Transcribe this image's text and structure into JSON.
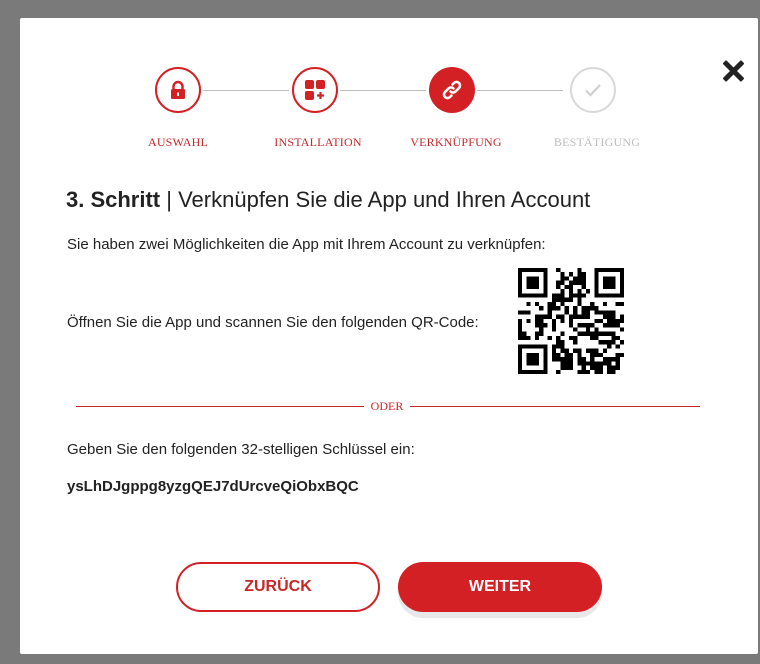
{
  "close_icon": "close-icon",
  "steps": [
    {
      "label": "AUSWAHL",
      "icon": "lock-icon",
      "state": "done"
    },
    {
      "label": "INSTALLATION",
      "icon": "app-grid-icon",
      "state": "done"
    },
    {
      "label": "VERKNÜPFUNG",
      "icon": "link-icon",
      "state": "active"
    },
    {
      "label": "BESTÄTIGUNG",
      "icon": "check-icon",
      "state": "upcoming"
    }
  ],
  "heading": {
    "step": "3. Schritt",
    "separator": " | ",
    "text": "Verknüpfen Sie die App und Ihren Account"
  },
  "intro": "Sie haben zwei Möglichkeiten die App mit Ihrem Account zu verknüpfen:",
  "qr_instruction": "Öffnen Sie die App und scannen Sie den folgenden QR-Code:",
  "divider_label": "ODER",
  "key_instruction": "Geben Sie den folgenden 32-stelligen Schlüssel ein:",
  "key_value": "ysLhDJgppg8yzgQEJ7dUrcveQiObxBQC",
  "buttons": {
    "back": "ZURÜCK",
    "next": "WEITER"
  },
  "colors": {
    "accent": "#d32024",
    "disabled": "#d9d9d9",
    "text": "#222222"
  }
}
